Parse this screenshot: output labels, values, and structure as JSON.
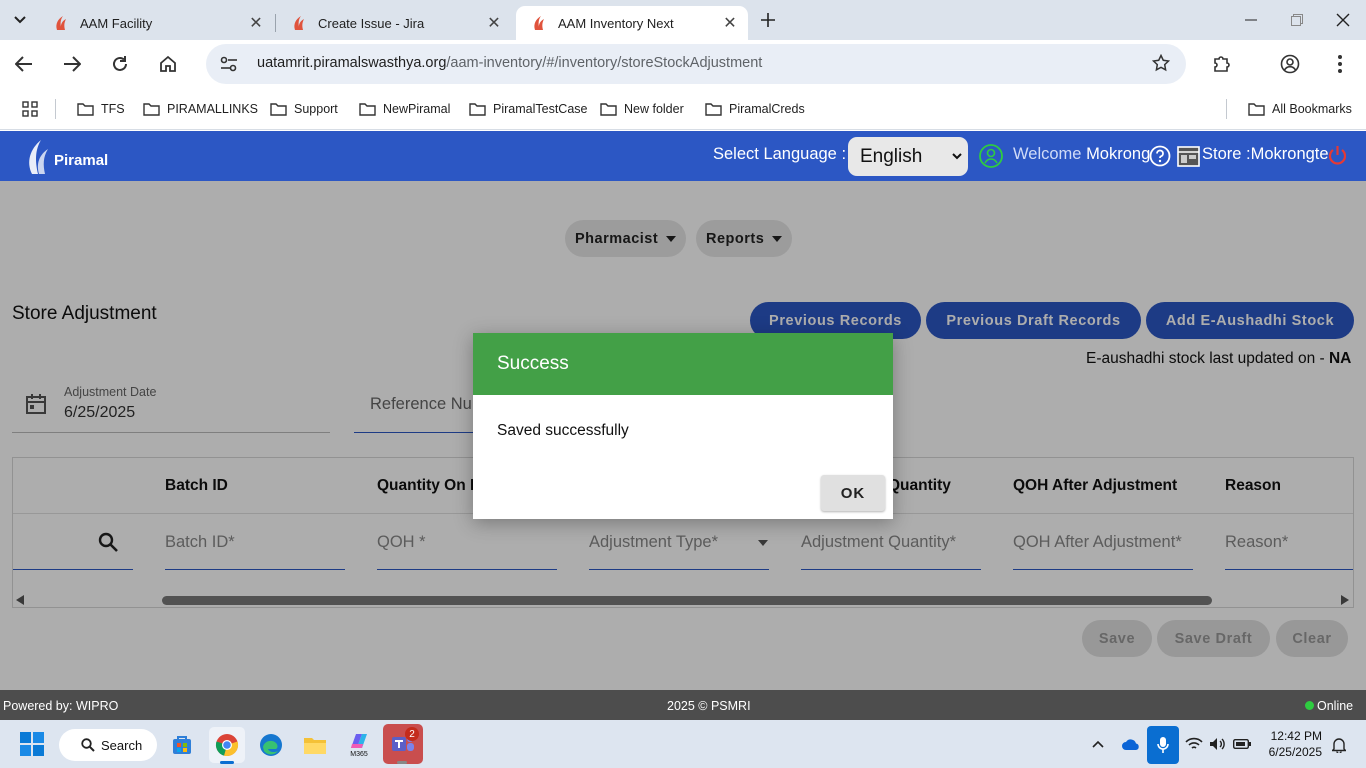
{
  "browser": {
    "tabs": [
      {
        "title": "AAM Facility"
      },
      {
        "title": "Create Issue - Jira"
      },
      {
        "title": "AAM Inventory Next"
      }
    ],
    "url_host": "uatamrit.piramalswasthya.org",
    "url_path": "/aam-inventory/#/inventory/storeStockAdjustment",
    "bookmarks": [
      "TFS",
      "PIRAMALLINKS",
      "Support",
      "NewPiramal",
      "PiramalTestCase",
      "New folder",
      "PiramalCreds"
    ],
    "all_bookmarks": "All Bookmarks"
  },
  "header": {
    "logo_text": "Piramal",
    "select_language_label": "Select Language :",
    "language_value": "English",
    "welcome_label": "Welcome",
    "user_name": "Mokrong",
    "store_label": "Store :",
    "store_name": "Mokrongte"
  },
  "menu": {
    "pharmacist": "Pharmacist",
    "reports": "Reports"
  },
  "page": {
    "title": "Store Adjustment",
    "previous_records": "Previous Records",
    "previous_draft_records": "Previous Draft Records",
    "add_eaushadhi": "Add E-Aushadhi Stock",
    "eaushadhi_note": "E-aushadhi stock last updated on - ",
    "eaushadhi_value": "NA",
    "adjustment_date_label": "Adjustment Date",
    "adjustment_date_value": "6/25/2025",
    "reference_placeholder": "Reference Nu",
    "table": {
      "headers": [
        "Batch ID",
        "Quantity On H",
        "Quantity",
        "QOH After Adjustment",
        "Reason"
      ],
      "fields": [
        "Batch ID*",
        "QOH *",
        "Adjustment Type*",
        "Adjustment Quantity*",
        "QOH After Adjustment*",
        "Reason*"
      ]
    },
    "save": "Save",
    "save_draft": "Save Draft",
    "clear": "Clear"
  },
  "dialog": {
    "title": "Success",
    "message": "Saved successfully",
    "ok": "OK"
  },
  "footer": {
    "powered_by": "Powered by: WIPRO",
    "copyright": "2025 © PSMRI",
    "status": "Online"
  },
  "taskbar": {
    "search": "Search",
    "teams_badge": "2",
    "m365_label": "M365",
    "time": "12:42 PM",
    "date": "6/25/2025"
  },
  "colors": {
    "brand_blue": "#2c57c4",
    "success_green": "#43a047",
    "online_green": "#2ecc40",
    "power_red": "#e53935"
  }
}
